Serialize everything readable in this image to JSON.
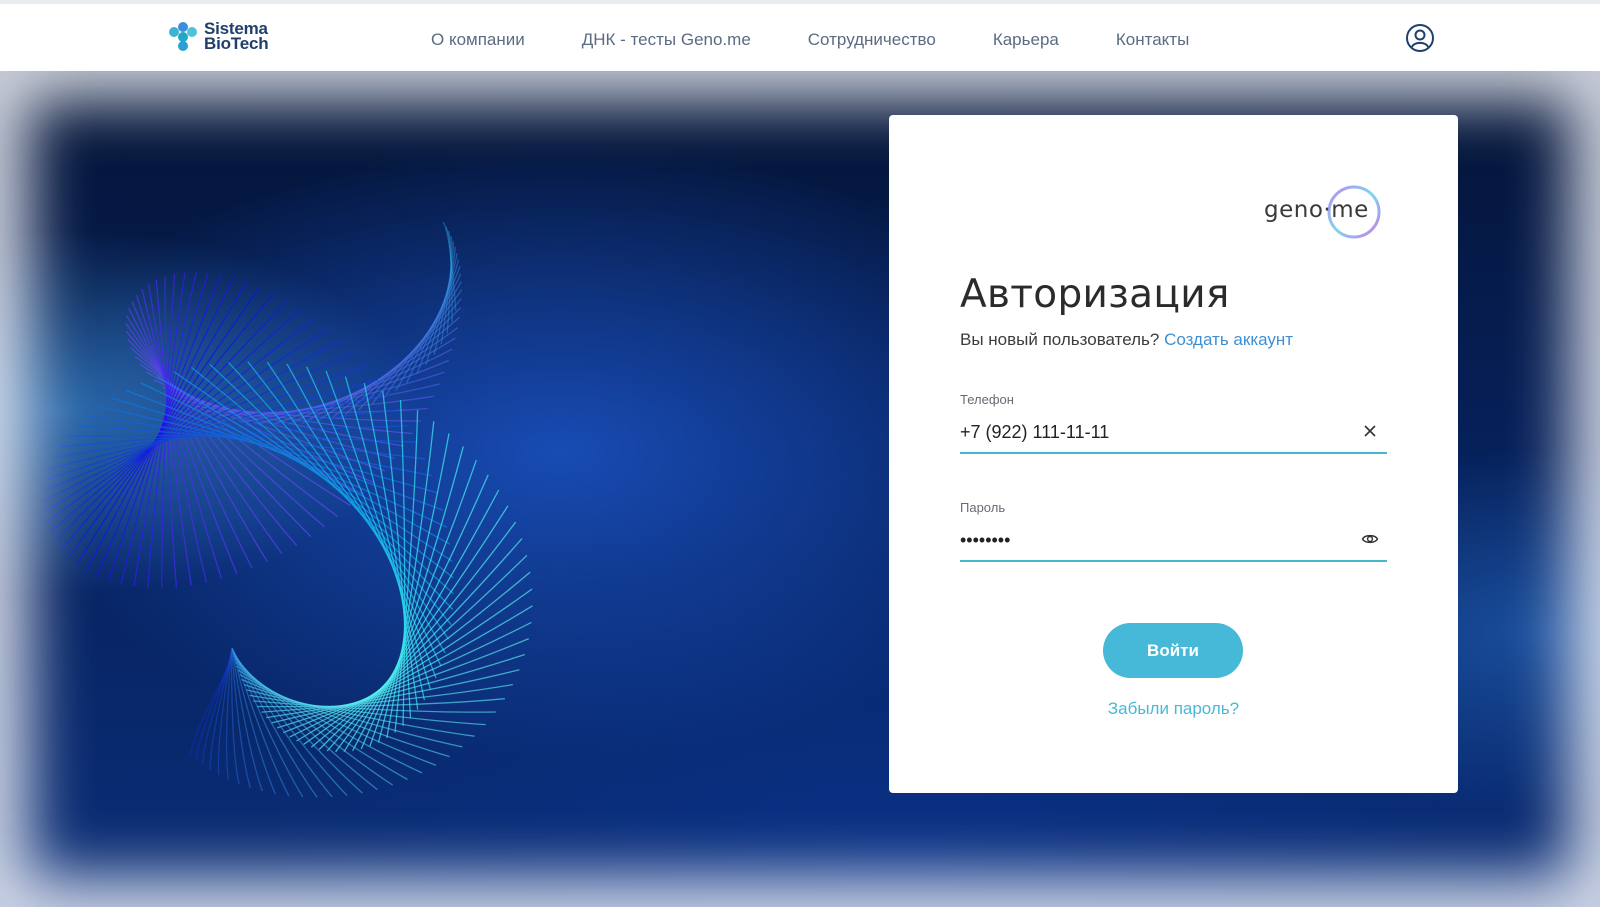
{
  "header": {
    "logo": {
      "line1": "Sistema",
      "line2": "BioTech"
    },
    "nav": [
      {
        "label": "О компании"
      },
      {
        "label": "ДНК - тесты Geno.me"
      },
      {
        "label": "Сотрудничество"
      },
      {
        "label": "Карьера"
      },
      {
        "label": "Контакты"
      }
    ],
    "user_icon": "user-circle-icon"
  },
  "login": {
    "brand": "geno·me",
    "title": "Авторизация",
    "new_user_text": "Вы новый пользователь?",
    "create_account_link": "Создать аккаунт",
    "phone": {
      "label": "Телефон",
      "value": "+7 (922) 111-11-11",
      "clear_icon": "close-icon"
    },
    "password": {
      "label": "Пароль",
      "value": "••••••••",
      "toggle_icon": "eye-icon"
    },
    "submit_label": "Войти",
    "forgot_link": "Забыли пароль?"
  },
  "colors": {
    "accent": "#47b9d8",
    "link": "#3f8fd2",
    "nav_text": "#5b6b82",
    "logo": "#1f3f6e",
    "hero_dark": "#041436"
  }
}
